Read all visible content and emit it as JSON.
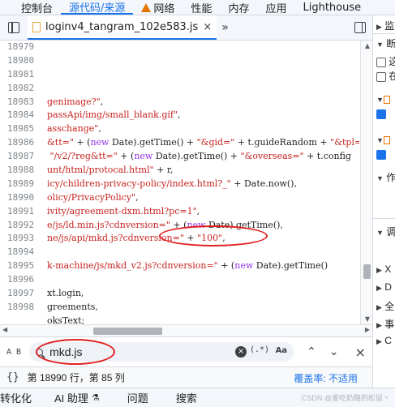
{
  "top_tabs": [
    {
      "label": "控制台"
    },
    {
      "label": "源代码/来源"
    },
    {
      "label": "网络"
    },
    {
      "label": "性能"
    },
    {
      "label": "内存"
    },
    {
      "label": "应用"
    },
    {
      "label": "Lighthouse"
    }
  ],
  "file_tab": {
    "name": "loginv4_tangram_102e583.js",
    "close": "×",
    "more": "»"
  },
  "line_numbers": [
    "18979",
    "18980",
    "18981",
    "18982",
    "18983",
    "18984",
    "18985",
    "18986",
    "18987",
    "18988",
    "18989",
    "18990",
    "18991",
    "18992",
    "18993",
    "18994",
    "18995",
    "18996",
    "18997",
    "18998"
  ],
  "code_lines": [
    "",
    "",
    "",
    "",
    "genimage?\",",
    "passApi/img/small_blank.gif\",",
    "asschange\",",
    "&tt=\" + (new Date).getTime() + \"&gid=\" + t.guideRandom + \"&tpl=\"",
    " \"/v2/?reg&tt=\" + (new Date).getTime() + \"&overseas=\" + t.config",
    "unt/html/protocal.html\" + r,",
    "icy/children-privacy-policy/index.html?_\" + Date.now(),",
    "olicy/PrivacyPolicy\",",
    "ivity/agreement-dxm.html?pc=1\",",
    "e/js/ld.min.js?cdnversion=\" + (new Date).getTime(),",
    "ne/js/api/mkd.js?cdnversion=\" + \"100\",",
    "",
    "k-machine/js/mkd_v2.js?cdnversion=\" + (new Date).getTime()",
    "",
    "xt.login,",
    "greements,",
    "oksText;"
  ],
  "search": {
    "value": "mkd.js",
    "case_label": "Aa",
    "regex_label": "(.*)",
    "aa_label": "A B"
  },
  "status": {
    "braces": "{}",
    "position": "第 18990 行，第 85 列",
    "coverage": "覆盖率: 不适用"
  },
  "drawer_tabs": [
    {
      "label": "转化化"
    },
    {
      "label": "AI 助理"
    },
    {
      "label": "问题"
    },
    {
      "label": "搜索"
    }
  ],
  "watermark": "CSDN @爱吃奶酪的松鼠丶",
  "right_panel": {
    "items": [
      "监",
      "断",
      "这",
      "在",
      "作",
      "调",
      "X",
      "D",
      "全",
      "事",
      "C"
    ]
  },
  "colors": {
    "accent": "#1a73e8",
    "annotation": "#e02020",
    "string": "#c5221f"
  }
}
